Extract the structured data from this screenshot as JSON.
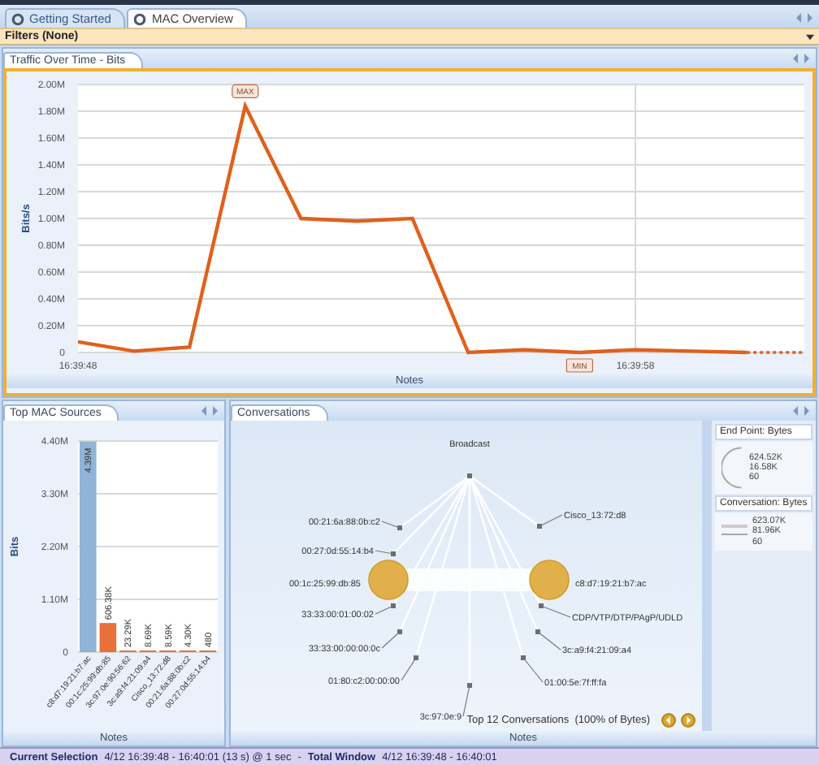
{
  "tabs": [
    {
      "label": "Getting Started",
      "selected": false
    },
    {
      "label": "MAC Overview",
      "selected": true
    }
  ],
  "filters": {
    "label": "Filters (None)"
  },
  "traffic_panel": {
    "title": "Traffic Over Time - Bits",
    "footer": "Notes",
    "chart_data": {
      "type": "line",
      "ylabel": "Bits/s",
      "grid": true,
      "categories": [
        "16:39:48",
        null,
        null,
        null,
        null,
        null,
        null,
        null,
        null,
        null,
        "16:39:58",
        null,
        null
      ],
      "series": [
        {
          "color": "#e0601c",
          "values": [
            80000,
            10000,
            40000,
            1840000,
            1000000,
            980000,
            1000000,
            0,
            20000,
            0,
            20000,
            10000,
            0
          ]
        }
      ],
      "ylim": [
        0,
        2000000
      ],
      "yticks": [
        {
          "value": 0,
          "label": "0"
        },
        {
          "value": 200000,
          "label": "0.20M"
        },
        {
          "value": 400000,
          "label": "0.40M"
        },
        {
          "value": 600000,
          "label": "0.60M"
        },
        {
          "value": 800000,
          "label": "0.80M"
        },
        {
          "value": 1000000,
          "label": "1.00M"
        },
        {
          "value": 1200000,
          "label": "1.20M"
        },
        {
          "value": 1400000,
          "label": "1.40M"
        },
        {
          "value": 1600000,
          "label": "1.60M"
        },
        {
          "value": 1800000,
          "label": "1.80M"
        },
        {
          "value": 2000000,
          "label": "2.00M"
        }
      ],
      "annotations": [
        "MAX",
        "MIN"
      ]
    }
  },
  "sources_panel": {
    "title": "Top MAC Sources",
    "footer": "Notes",
    "chart_data": {
      "type": "bar",
      "ylabel": "Bits",
      "grid": true,
      "categories": [
        "c8:d7:19:21:b7:ac",
        "00:1c:25:99:db:85",
        "3c:97:0e:90:56:62",
        "3c:a9:f4:21:09:a4",
        "Cisco_13:72:d8",
        "00:21:6a:88:0b:c2",
        "00:27:0d:55:14:b4"
      ],
      "colors": [
        "#8fb4d6",
        "#e8703a",
        "#e8703a",
        "#e8703a",
        "#e8703a",
        "#e8703a",
        "#e8703a"
      ],
      "values": [
        4390000,
        606380,
        23290,
        8690,
        8590,
        4300,
        480
      ],
      "value_labels": [
        "4.39M",
        "606.38K",
        "23.29K",
        "8.69K",
        "8.59K",
        "4.30K",
        "480"
      ],
      "ylim": [
        0,
        4400000
      ],
      "yticks": [
        {
          "value": 0,
          "label": "0"
        },
        {
          "value": 1100000,
          "label": "1.10M"
        },
        {
          "value": 2200000,
          "label": "2.20M"
        },
        {
          "value": 3300000,
          "label": "3.30M"
        },
        {
          "value": 4400000,
          "label": "4.40M"
        }
      ]
    }
  },
  "conversations_panel": {
    "title": "Conversations",
    "footer": "Notes",
    "nodes": [
      {
        "label": "Broadcast",
        "kind": "point"
      },
      {
        "label": "00:21:6a:88:0b:c2",
        "kind": "point"
      },
      {
        "label": "00:27:0d:55:14:b4",
        "kind": "point"
      },
      {
        "label": "00:1c:25:99:db:85",
        "kind": "hub"
      },
      {
        "label": "33:33:00:01:00:02",
        "kind": "point"
      },
      {
        "label": "33:33:00:00:00:0c",
        "kind": "point"
      },
      {
        "label": "01:80:c2:00:00:00",
        "kind": "point"
      },
      {
        "label": "3c:97:0e:9",
        "kind": "point"
      },
      {
        "label": "Cisco_13:72:d8",
        "kind": "point"
      },
      {
        "label": "c8:d7:19:21:b7:ac",
        "kind": "hub"
      },
      {
        "label": "CDP/VTP/DTP/PAgP/UDLD",
        "kind": "point"
      },
      {
        "label": "3c:a9:f4:21:09:a4",
        "kind": "point"
      },
      {
        "label": "01:00:5e:7f:ff:fa",
        "kind": "point"
      }
    ],
    "summary": "Top 12 Conversations  (100% of Bytes)",
    "legend": [
      {
        "title": "End Point: Bytes",
        "kind": "arc",
        "max": "624.52K",
        "min": "16.58K",
        "zero": "60"
      },
      {
        "title": "Conversation: Bytes",
        "kind": "lines",
        "max": "623.07K",
        "min": "81.96K",
        "zero": "60"
      }
    ]
  },
  "status_bar": {
    "selection_label": "Current Selection",
    "selection": "4/12 16:39:48 - 16:40:01 (13 s) @ 1 sec",
    "separator": "-",
    "window_label": "Total Window",
    "window": "4/12 16:39:48 - 16:40:01"
  }
}
